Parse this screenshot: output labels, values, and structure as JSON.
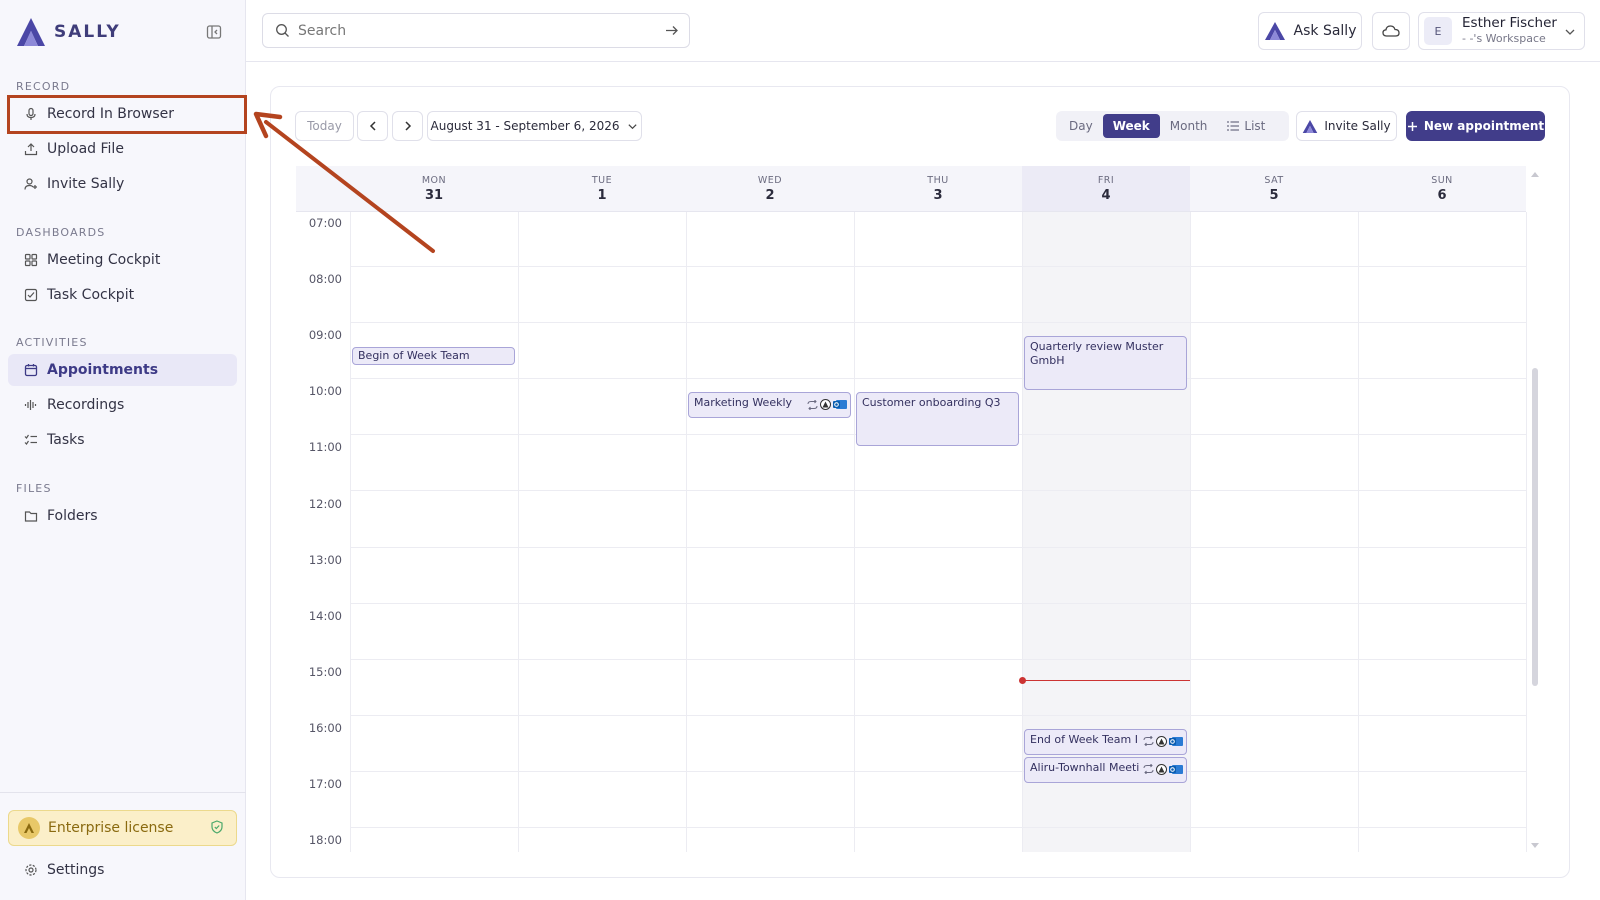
{
  "app": {
    "name": "SALLY"
  },
  "sidebar": {
    "sections": [
      {
        "label": "RECORD"
      },
      {
        "label": "DASHBOARDS"
      },
      {
        "label": "ACTIVITIES"
      },
      {
        "label": "FILES"
      }
    ],
    "items": {
      "record_in_browser": "Record In Browser",
      "upload_file": "Upload File",
      "invite_sally": "Invite Sally",
      "meeting_cockpit": "Meeting Cockpit",
      "task_cockpit": "Task Cockpit",
      "appointments": "Appointments",
      "recordings": "Recordings",
      "tasks": "Tasks",
      "folders": "Folders"
    },
    "license": "Enterprise license",
    "settings": "Settings"
  },
  "topbar": {
    "search_placeholder": "Search",
    "ask_sally": "Ask Sally",
    "user": {
      "initial": "E",
      "name": "Esther Fischer",
      "workspace": "- -'s Workspace"
    }
  },
  "calendar": {
    "today_label": "Today",
    "range_label": "August 31 - September 6, 2026",
    "views": {
      "day": "Day",
      "week": "Week",
      "month": "Month",
      "list": "List"
    },
    "active_view": "Week",
    "invite_label": "Invite Sally",
    "new_label": "New appointment",
    "days": [
      {
        "dow": "MON",
        "num": "31"
      },
      {
        "dow": "TUE",
        "num": "1"
      },
      {
        "dow": "WED",
        "num": "2"
      },
      {
        "dow": "THU",
        "num": "3"
      },
      {
        "dow": "FRI",
        "num": "4"
      },
      {
        "dow": "SAT",
        "num": "5"
      },
      {
        "dow": "SUN",
        "num": "6"
      }
    ],
    "hours": [
      "07:00",
      "08:00",
      "09:00",
      "10:00",
      "11:00",
      "12:00",
      "13:00",
      "14:00",
      "15:00",
      "16:00",
      "17:00",
      "18:00"
    ],
    "events": [
      {
        "title": "Begin of Week Team Internal",
        "day": 0,
        "start": 9.2,
        "end": 9.5,
        "icons": false
      },
      {
        "title": "Quarterly review Muster GmbH",
        "day": 4,
        "start": 9.0,
        "end": 10.0,
        "icons": false
      },
      {
        "title": "Marketing Weekly",
        "day": 2,
        "start": 10.0,
        "end": 10.5,
        "icons": true
      },
      {
        "title": "Customer onboarding Q3",
        "day": 3,
        "start": 10.0,
        "end": 11.0,
        "icons": false
      },
      {
        "title": "End of Week Team Int",
        "day": 4,
        "start": 16.0,
        "end": 16.5,
        "icons": true
      },
      {
        "title": "Aliru-Townhall Meetir",
        "day": 4,
        "start": 16.5,
        "end": 17.0,
        "icons": true
      }
    ],
    "now": {
      "day": 4,
      "hour": 14.85
    },
    "colors": {
      "accent": "#413d8a",
      "event_bg": "#eceaf8",
      "now": "#cc3333",
      "annotation": "#b4441f"
    }
  }
}
